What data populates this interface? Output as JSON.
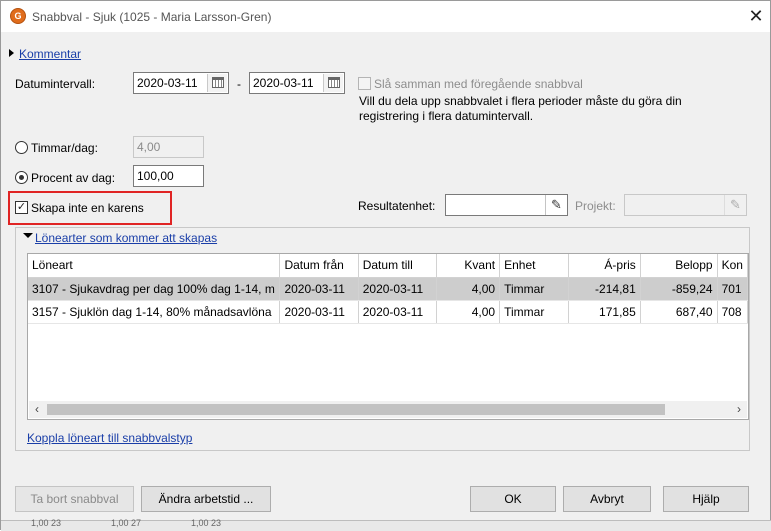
{
  "window": {
    "title": "Snabbval - Sjuk (1025 - Maria Larsson-Gren)",
    "app_icon_text": "G"
  },
  "kommentar": {
    "label": "Kommentar"
  },
  "datumintervall": {
    "label": "Datumintervall:",
    "from": "2020-03-11",
    "separator": "-",
    "to": "2020-03-11"
  },
  "merge": {
    "label": "Slå samman med föregående snabbval",
    "info_line1": "Vill du dela upp snabbvalet i flera perioder måste du göra din",
    "info_line2": "registrering i flera datumintervall."
  },
  "timmar": {
    "label": "Timmar/dag:",
    "value": "4,00"
  },
  "procent": {
    "label": "Procent av dag:",
    "value": "100,00"
  },
  "karens": {
    "label": "Skapa inte en karens"
  },
  "resultatenhet": {
    "label": "Resultatenhet:",
    "value": ""
  },
  "projekt": {
    "label": "Projekt:",
    "value": ""
  },
  "lonearter": {
    "header": "Lönearter som kommer att skapas",
    "columns": [
      "Löneart",
      "Datum från",
      "Datum till",
      "Kvant",
      "Enhet",
      "Á-pris",
      "Belopp",
      "Kon"
    ],
    "rows": [
      [
        "3107 - Sjukavdrag per dag 100% dag 1-14, m",
        "2020-03-11",
        "2020-03-11",
        "4,00",
        "Timmar",
        "-214,81",
        "-859,24",
        "701"
      ],
      [
        "3157 - Sjuklön dag 1-14, 80% månadsavlöna",
        "2020-03-11",
        "2020-03-11",
        "4,00",
        "Timmar",
        "171,85",
        "687,40",
        "708"
      ]
    ],
    "link": "Koppla löneart till snabbvalstyp"
  },
  "buttons": {
    "delete": "Ta bort snabbval",
    "change_worktime": "Ändra arbetstid ...",
    "ok": "OK",
    "cancel": "Avbryt",
    "help": "Hjälp"
  },
  "bottom_fragments": [
    "1,00 23",
    "1,00 27",
    "1,00 23"
  ]
}
